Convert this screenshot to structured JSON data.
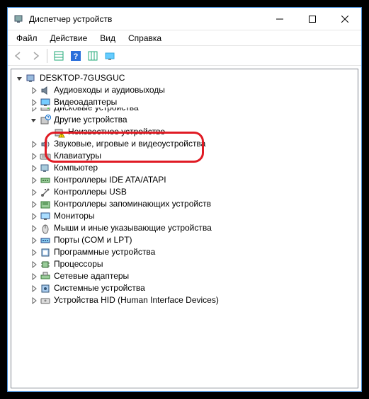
{
  "titlebar": {
    "title": "Диспетчер устройств"
  },
  "menubar": {
    "items": [
      {
        "label": "Файл"
      },
      {
        "label": "Действие"
      },
      {
        "label": "Вид"
      },
      {
        "label": "Справка"
      }
    ]
  },
  "tree": {
    "root": {
      "label": "DESKTOP-7GUSGUC"
    },
    "nodes": [
      {
        "label": "Аудиовходы и аудиовыходы",
        "icon": "audio",
        "expanded": false
      },
      {
        "label": "Видеоадаптеры",
        "icon": "display",
        "expanded": false
      },
      {
        "label": "Дисковые устройства",
        "icon": "disk",
        "expanded": false,
        "partial": true
      },
      {
        "label": "Другие устройства",
        "icon": "unknown-cat",
        "expanded": true,
        "highlighted": true,
        "children": [
          {
            "label": "Неизвестное устройство",
            "icon": "unknown-warn"
          }
        ]
      },
      {
        "label": "Звуковые, игровые и видеоустройства",
        "icon": "sound",
        "expanded": false
      },
      {
        "label": "Клавиатуры",
        "icon": "keyboard",
        "expanded": false
      },
      {
        "label": "Компьютер",
        "icon": "computer",
        "expanded": false
      },
      {
        "label": "Контроллеры IDE ATA/ATAPI",
        "icon": "ide",
        "expanded": false
      },
      {
        "label": "Контроллеры USB",
        "icon": "usb",
        "expanded": false
      },
      {
        "label": "Контроллеры запоминающих устройств",
        "icon": "storage",
        "expanded": false
      },
      {
        "label": "Мониторы",
        "icon": "monitor",
        "expanded": false
      },
      {
        "label": "Мыши и иные указывающие устройства",
        "icon": "mouse",
        "expanded": false
      },
      {
        "label": "Порты (COM и LPT)",
        "icon": "port",
        "expanded": false
      },
      {
        "label": "Программные устройства",
        "icon": "software",
        "expanded": false
      },
      {
        "label": "Процессоры",
        "icon": "cpu",
        "expanded": false
      },
      {
        "label": "Сетевые адаптеры",
        "icon": "network",
        "expanded": false
      },
      {
        "label": "Системные устройства",
        "icon": "system",
        "expanded": false
      },
      {
        "label": "Устройства HID (Human Interface Devices)",
        "icon": "hid",
        "expanded": false
      }
    ]
  }
}
